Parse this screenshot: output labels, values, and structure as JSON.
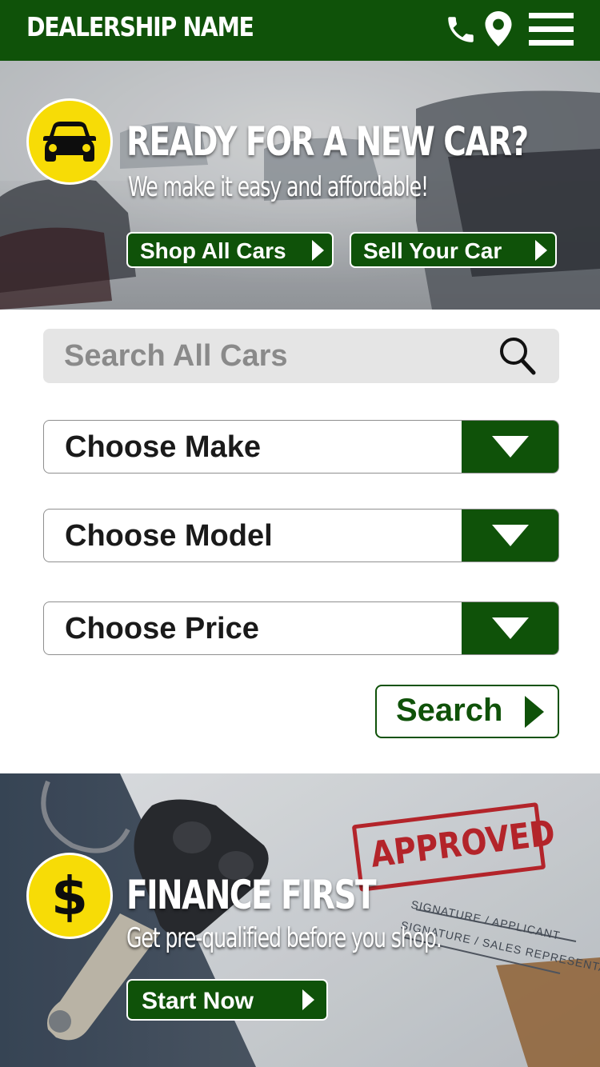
{
  "header": {
    "brand": "DEALERSHIP NAME",
    "icons": [
      "phone-icon",
      "location-pin-icon",
      "menu-icon"
    ],
    "color": "#0f5209"
  },
  "hero": {
    "icon": "car-icon",
    "title": "READY FOR A NEW CAR?",
    "subtitle": "We make it easy and affordable!",
    "buttons": [
      {
        "label": "Shop All Cars"
      },
      {
        "label": "Sell Your Car"
      }
    ]
  },
  "search": {
    "placeholder": "Search All Cars",
    "selects": [
      {
        "label": "Choose Make"
      },
      {
        "label": "Choose Model"
      },
      {
        "label": "Choose Price"
      }
    ],
    "submit_label": "Search"
  },
  "finance": {
    "icon": "dollar-icon",
    "title": "FINANCE FIRST",
    "subtitle": "Get pre-qualified before you shop.",
    "button_label": "Start Now",
    "stamp_text": "APPROVED",
    "doc_labels": [
      "SIGNATURE / APPLICANT",
      "SIGNATURE / SALES REPRESENTATIVE"
    ]
  },
  "colors": {
    "brand_green": "#0f5209",
    "badge_yellow": "#f7dc06",
    "stamp_red": "#b3242a"
  }
}
